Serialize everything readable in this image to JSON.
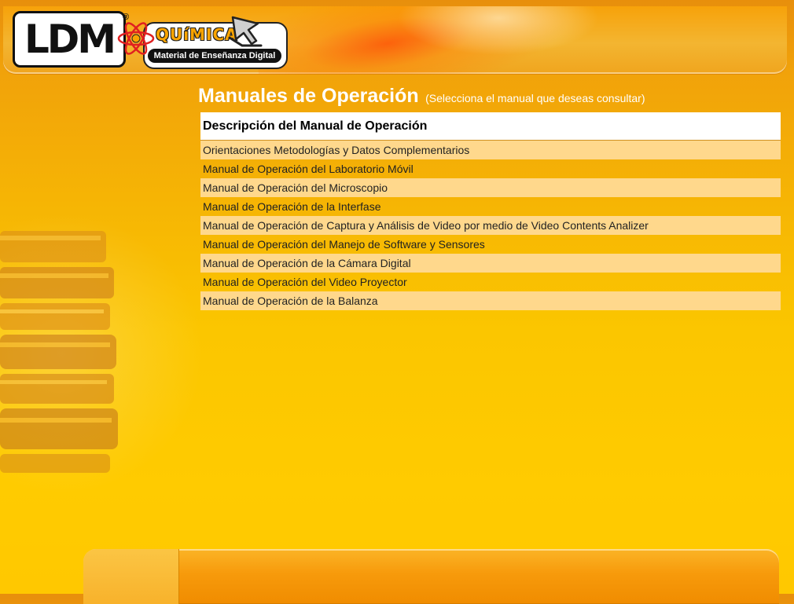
{
  "header": {
    "logo_text": "LDM",
    "logo_reg": "®",
    "brand_word": "QUíMICA",
    "tagline": "Material de Enseñanza Digital"
  },
  "main": {
    "title": "Manuales de Operación",
    "subtitle": "(Selecciona el manual que deseas consultar)",
    "table_header": "Descripción del Manual de Operación",
    "rows": [
      "Orientaciones Metodologías y Datos Complementarios",
      "Manual de Operación del Laboratorio Móvil",
      "Manual de Operación del Microscopio",
      "Manual de Operación de la Interfase",
      "Manual de Operación de Captura y Análisis de Video por medio de Video Contents Analizer",
      "Manual de Operación del Manejo de Software y Sensores",
      "Manual de Operación de la Cámara Digital",
      "Manual de Operación del Video Proyector",
      "Manual de Operación de la Balanza"
    ]
  },
  "colors": {
    "row_highlight": "#ffd88c",
    "title_text": "#ffffff",
    "brand_orange": "#f9a400"
  },
  "icons": {
    "atom": "atom-icon",
    "cursor": "pointer-cursor-icon",
    "books": "books-illustration"
  }
}
